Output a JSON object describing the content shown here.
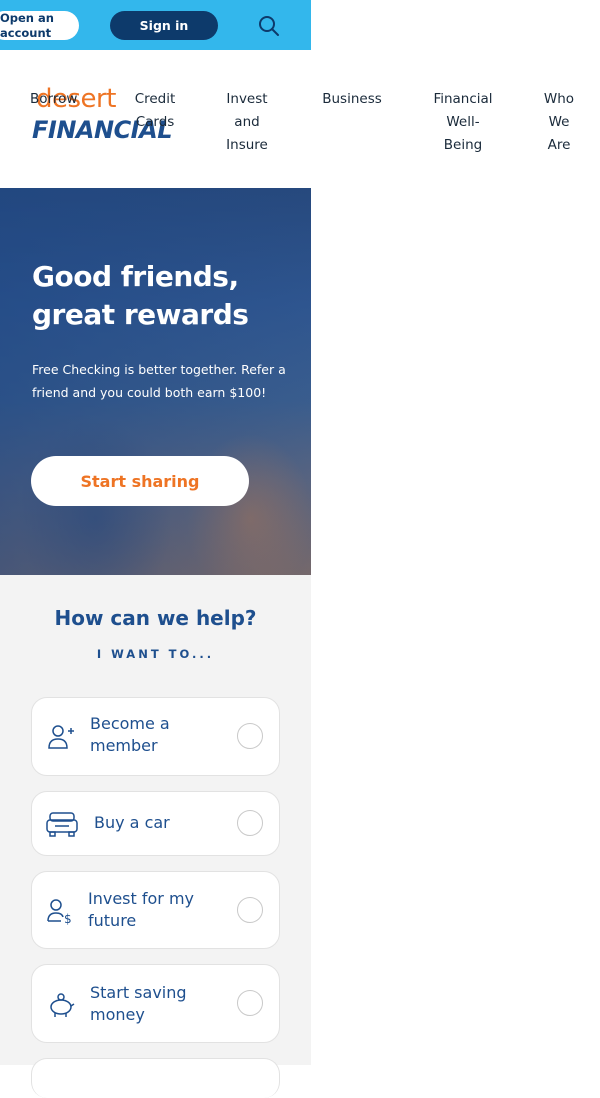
{
  "utility_bar": {
    "open_account": "Open an account",
    "sign_in": "Sign in",
    "search_icon": "search-icon"
  },
  "logo": {
    "line1": "desert",
    "line2": "FINANCIAL"
  },
  "nav": {
    "items": [
      {
        "label": "Borrow"
      },
      {
        "label": "Credit Cards"
      },
      {
        "label": "Invest and Insure"
      },
      {
        "label": "Business"
      },
      {
        "label": "Financial Well-Being"
      },
      {
        "label": "Who We Are"
      }
    ]
  },
  "hero": {
    "title": "Good friends, great rewards",
    "text": "Free Checking is better together. Refer a friend and you could both earn $100!",
    "cta": "Start sharing"
  },
  "help": {
    "title": "How can we help?",
    "subtitle": "I WANT TO...",
    "options": [
      {
        "label": "Become a member",
        "icon": "add-person-icon"
      },
      {
        "label": "Buy a car",
        "icon": "car-icon"
      },
      {
        "label": "Invest for my future",
        "icon": "person-money-icon"
      },
      {
        "label": "Start saving money",
        "icon": "piggy-bank-icon"
      }
    ]
  },
  "colors": {
    "utility_bar": "#33b7ec",
    "navy": "#0d3a6b",
    "brand_blue": "#1e4f8e",
    "brand_orange": "#ee7424"
  }
}
